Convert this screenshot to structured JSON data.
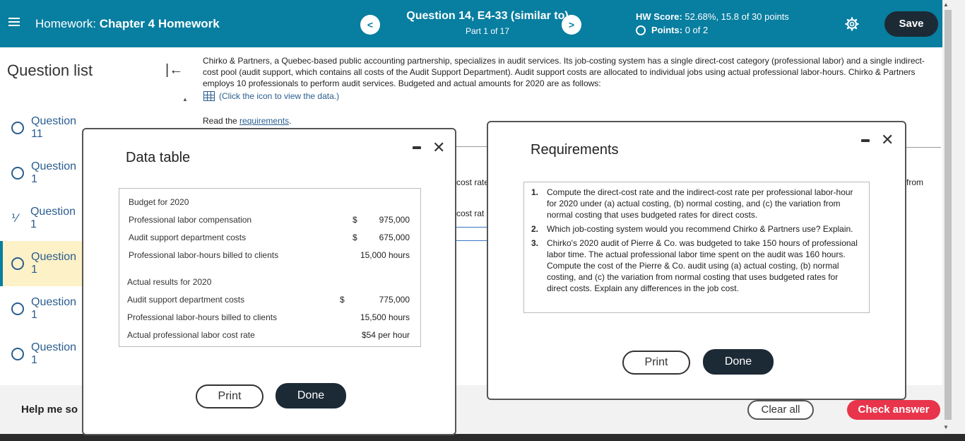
{
  "header": {
    "title_prefix": "Homework:",
    "title": "Chapter 4 Homework",
    "question_title": "Question 14, E4-33 (similar to)",
    "part": "Part 1 of 17",
    "hw_score_label": "HW Score:",
    "hw_score_value": "52.68%, 15.8 of 30 points",
    "points_label": "Points:",
    "points_value": "0 of 2",
    "save_label": "Save",
    "prev_glyph": "<",
    "next_glyph": ">"
  },
  "sidebar": {
    "title": "Question list",
    "items": [
      {
        "label": "Question 11"
      },
      {
        "label": "Question 1"
      },
      {
        "label": "Question 1"
      },
      {
        "label": "Question 1"
      },
      {
        "label": "Question 1"
      },
      {
        "label": "Question 1"
      }
    ],
    "help_label": "Help me so"
  },
  "main": {
    "problem_text": "Chirko & Partners, a Quebec-based public accounting partnership, specializes in audit services. Its job-costing system has a single direct-cost category (professional labor) and a single indirect-cost pool (audit support, which contains all costs of the Audit Support Department). Audit support costs are allocated to individual jobs using actual professional labor-hours. Chirko & Partners employs 10 professionals to perform audit services. Budgeted and actual amounts for 2020 are as follows:",
    "data_link": "(Click the icon to view the data.)",
    "read_prefix": "Read the ",
    "read_link": "requirements",
    "read_suffix": ".",
    "bg_cost_rate_1": "cost rate",
    "bg_cost_rate_2": "cost rat",
    "bg_from": "from",
    "clear_all": "Clear all",
    "check_answer": "Check answer"
  },
  "data_table": {
    "title": "Data table",
    "budget_heading": "Budget for 2020",
    "budget_rows": [
      {
        "label": "Professional labor compensation",
        "currency": "$",
        "value": "975,000"
      },
      {
        "label": "Audit support department costs",
        "currency": "$",
        "value": "675,000"
      },
      {
        "label": "Professional labor-hours billed to clients",
        "currency": "",
        "value": "15,000 hours"
      }
    ],
    "actual_heading": "Actual results for 2020",
    "actual_rows": [
      {
        "label": "Audit support department costs",
        "currency": "$",
        "value": "775,000"
      },
      {
        "label": "Professional labor-hours billed to clients",
        "currency": "",
        "value": "15,500 hours"
      },
      {
        "label": "Actual professional labor cost rate",
        "currency": "",
        "value": "$54 per hour"
      }
    ],
    "print_label": "Print",
    "done_label": "Done"
  },
  "requirements": {
    "title": "Requirements",
    "items": [
      {
        "num": "1.",
        "text": "Compute the direct-cost rate and the indirect-cost rate per professional labor-hour for 2020 under (a) actual costing, (b) normal costing, and (c) the variation from normal costing that uses budgeted rates for direct costs."
      },
      {
        "num": "2.",
        "text": "Which job-costing system would you recommend Chirko & Partners use? Explain."
      },
      {
        "num": "3.",
        "text": "Chirko's 2020 audit of Pierre & Co. was budgeted to take 150 hours of professional labor time. The actual professional labor time spent on the audit was 160 hours. Compute the cost of the Pierre & Co. audit using (a) actual costing, (b) normal costing, and (c) the variation from normal costing that uses budgeted rates for direct costs. Explain any differences in the job cost."
      }
    ],
    "print_label": "Print",
    "done_label": "Done"
  },
  "colors": {
    "header_bg": "#087ea0",
    "dark_button": "#1c2a36",
    "check_answer": "#e8354b",
    "active_item_bg": "#fdf1c7"
  }
}
